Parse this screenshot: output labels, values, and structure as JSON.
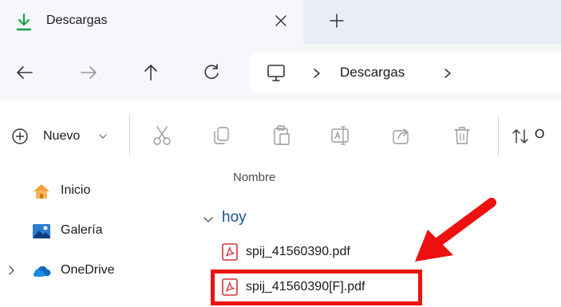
{
  "tab": {
    "title": "Descargas",
    "icon": "download-icon"
  },
  "address": {
    "segment": "Descargas"
  },
  "toolbar": {
    "new_label": "Nuevo",
    "sort_label": "O"
  },
  "sidebar": {
    "items": [
      {
        "label": "Inicio",
        "icon": "home-icon"
      },
      {
        "label": "Galería",
        "icon": "gallery-icon"
      },
      {
        "label": "OneDrive",
        "icon": "onedrive-icon"
      }
    ]
  },
  "list": {
    "column_name": "Nombre",
    "group": "hoy",
    "files": [
      {
        "name": "spij_41560390.pdf",
        "icon": "pdf-icon"
      },
      {
        "name": "spij_41560390[F].pdf",
        "icon": "pdf-icon"
      }
    ]
  },
  "colors": {
    "accent": "#1e4f91",
    "download_green": "#1a9e4a",
    "highlight_red": "#ee1111",
    "pdf_red": "#d13438"
  }
}
